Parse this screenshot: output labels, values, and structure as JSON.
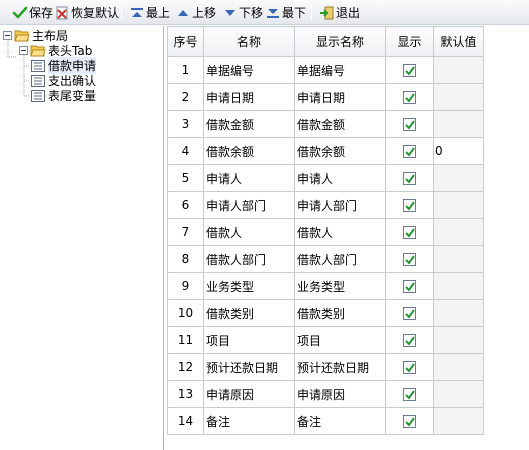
{
  "toolbar": {
    "save": "保存",
    "restore": "恢复默认",
    "top": "最上",
    "up": "上移",
    "down": "下移",
    "bottom": "最下",
    "exit": "退出"
  },
  "tree": {
    "root": "主布局",
    "group": "表头Tab",
    "items": [
      "借款申请",
      "支出确认",
      "表尾变量"
    ]
  },
  "grid": {
    "headers": [
      "序号",
      "名称",
      "显示名称",
      "显示",
      "默认值"
    ],
    "rows": [
      {
        "no": "1",
        "name": "单据编号",
        "display": "单据编号",
        "show": true,
        "default": ""
      },
      {
        "no": "2",
        "name": "申请日期",
        "display": "申请日期",
        "show": true,
        "default": ""
      },
      {
        "no": "3",
        "name": "借款金额",
        "display": "借款金额",
        "show": true,
        "default": ""
      },
      {
        "no": "4",
        "name": "借款余额",
        "display": "借款余额",
        "show": true,
        "default": "0"
      },
      {
        "no": "5",
        "name": "申请人",
        "display": "申请人",
        "show": true,
        "default": ""
      },
      {
        "no": "6",
        "name": "申请人部门",
        "display": "申请人部门",
        "show": true,
        "default": ""
      },
      {
        "no": "7",
        "name": "借款人",
        "display": "借款人",
        "show": true,
        "default": ""
      },
      {
        "no": "8",
        "name": "借款人部门",
        "display": "借款人部门",
        "show": true,
        "default": ""
      },
      {
        "no": "9",
        "name": "业务类型",
        "display": "业务类型",
        "show": true,
        "default": ""
      },
      {
        "no": "10",
        "name": "借款类别",
        "display": "借款类别",
        "show": true,
        "default": ""
      },
      {
        "no": "11",
        "name": "项目",
        "display": "项目",
        "show": true,
        "default": ""
      },
      {
        "no": "12",
        "name": "预计还款日期",
        "display": "预计还款日期",
        "show": true,
        "default": ""
      },
      {
        "no": "13",
        "name": "申请原因",
        "display": "申请原因",
        "show": true,
        "default": ""
      },
      {
        "no": "14",
        "name": "备注",
        "display": "备注",
        "show": true,
        "default": ""
      }
    ]
  },
  "colors": {
    "check": "#1e9a2e",
    "selection": "#e4ecf7",
    "folder": "#f3c94f"
  }
}
